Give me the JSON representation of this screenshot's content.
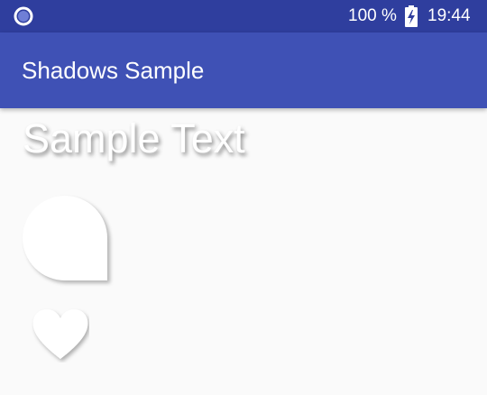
{
  "status_bar": {
    "battery_percent": "100 %",
    "time": "19:44",
    "notification_icon": "circle-notification-icon",
    "battery_icon": "battery-charging-icon"
  },
  "app_bar": {
    "title": "Shadows Sample"
  },
  "content": {
    "sample_text": "Sample Text",
    "shapes": [
      "teardrop-shape",
      "heart-shape"
    ]
  },
  "colors": {
    "status_bar": "#2f3e9e",
    "app_bar": "#3f51b5",
    "background": "#fafafa",
    "shape_fill": "#ffffff"
  }
}
